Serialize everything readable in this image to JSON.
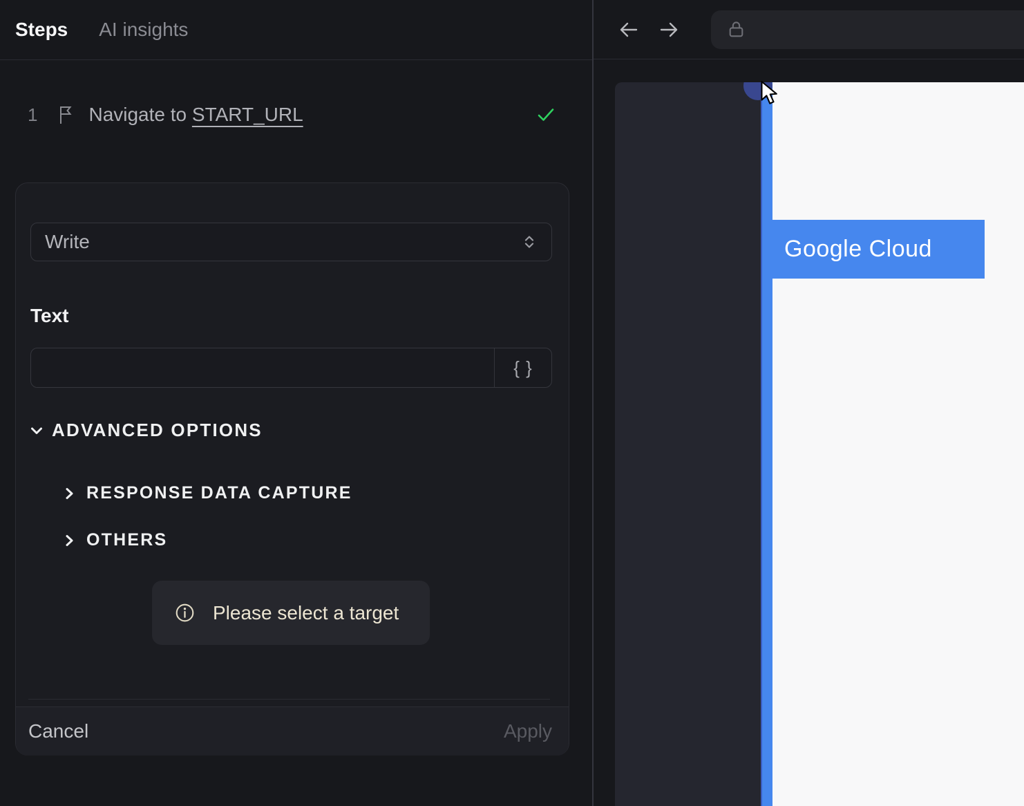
{
  "tabs": {
    "steps": "Steps",
    "ai_insights": "AI insights"
  },
  "step": {
    "number": "1",
    "text": "Navigate to ",
    "link": "START_URL"
  },
  "editor": {
    "action_select": {
      "value": "Write"
    },
    "text_label": "Text",
    "text_input": {
      "value": "",
      "placeholder": ""
    },
    "braces_button": "{ }",
    "advanced_options_label": "ADVANCED OPTIONS",
    "sections": [
      {
        "label": "RESPONSE DATA CAPTURE"
      },
      {
        "label": "OTHERS"
      }
    ],
    "hint": "Please select a target",
    "cancel_label": "Cancel",
    "apply_label": "Apply"
  },
  "browser": {
    "address_value": "",
    "page": {
      "highlight_text": "Google Cloud"
    }
  },
  "colors": {
    "accent_blue": "#4687ee",
    "success_green": "#2fd15f",
    "hint_cream": "#ece5d2",
    "panel_dark": "#17181c"
  }
}
